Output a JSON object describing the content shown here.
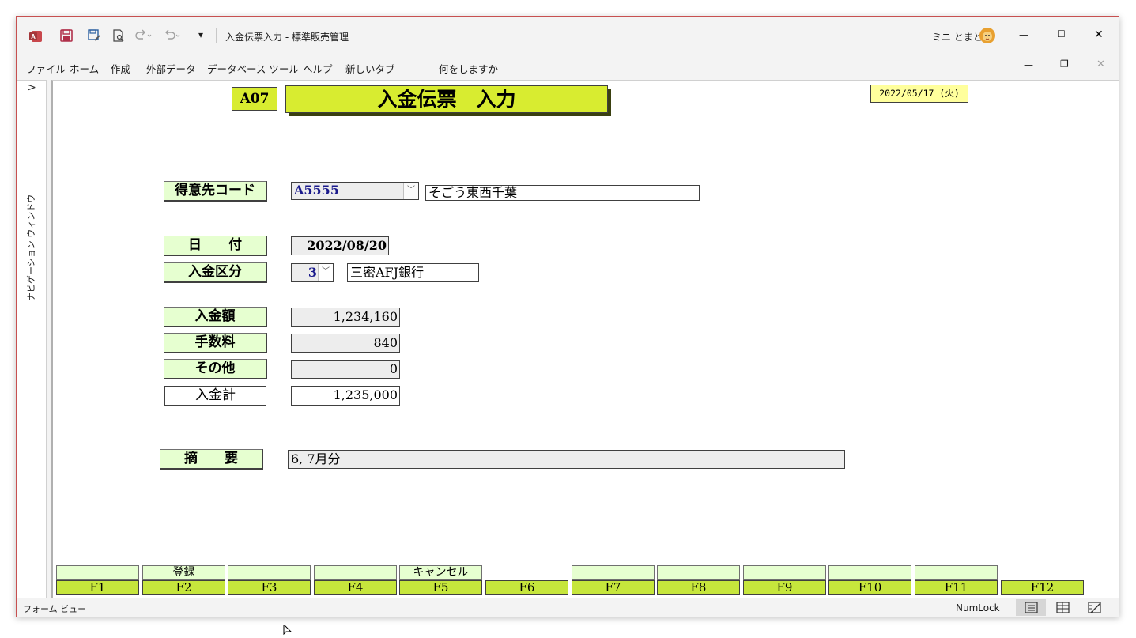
{
  "window": {
    "title": "入金伝票入力 - 標準販売管理",
    "user_name": "ミニ とまと",
    "qat": {
      "customize": "▾"
    },
    "controls": {
      "minimize": "—",
      "maximize": "☐",
      "close": "✕"
    },
    "doc_controls": {
      "minimize": "—",
      "restore": "❐",
      "close": "✕"
    }
  },
  "menu": {
    "items": [
      "ファイル",
      "ホーム",
      "作成",
      "外部データ",
      "データベース ツール",
      "ヘルプ",
      "新しいタブ"
    ],
    "search_label": "何をしますか"
  },
  "nav": {
    "toggle": ">",
    "label": "ナビゲーション ウィンドウ"
  },
  "form": {
    "code": "A07",
    "title": "入金伝票　入力",
    "date_display": "2022/05/17 (火)",
    "customer_code_label": "得意先コード",
    "customer_code": "A5555",
    "customer_name": "そごう東西千葉",
    "date_label": "日　　付",
    "date": "2022/08/20",
    "payment_type_label": "入金区分",
    "payment_type": "3",
    "payment_type_name": "三密AFJ銀行",
    "amount_label": "入金額",
    "amount": "1,234,160",
    "fee_label": "手数料",
    "fee": "840",
    "other_label": "その他",
    "other": "0",
    "total_label": "入金計",
    "total": "1,235,000",
    "memo_label": "摘　　要",
    "memo": "6, 7月分"
  },
  "fkeys": [
    {
      "top": "",
      "bottom": "F1"
    },
    {
      "top": "登録",
      "bottom": "F2"
    },
    {
      "top": "",
      "bottom": "F3"
    },
    {
      "top": "",
      "bottom": "F4"
    },
    {
      "top": "キャンセル",
      "bottom": "F5"
    },
    {
      "top": null,
      "bottom": "F6"
    },
    {
      "top": "",
      "bottom": "F7"
    },
    {
      "top": "",
      "bottom": "F8"
    },
    {
      "top": "",
      "bottom": "F9"
    },
    {
      "top": "",
      "bottom": "F10"
    },
    {
      "top": "",
      "bottom": "F11"
    },
    {
      "top": null,
      "bottom": "F12"
    }
  ],
  "status": {
    "view_name": "フォーム ビュー",
    "numlock": "NumLock"
  },
  "colors": {
    "label_bg": "#e6ffd0",
    "title_bg": "#d8ec30",
    "fkey_bg": "#c6e63c",
    "access_red": "#a4373a"
  }
}
